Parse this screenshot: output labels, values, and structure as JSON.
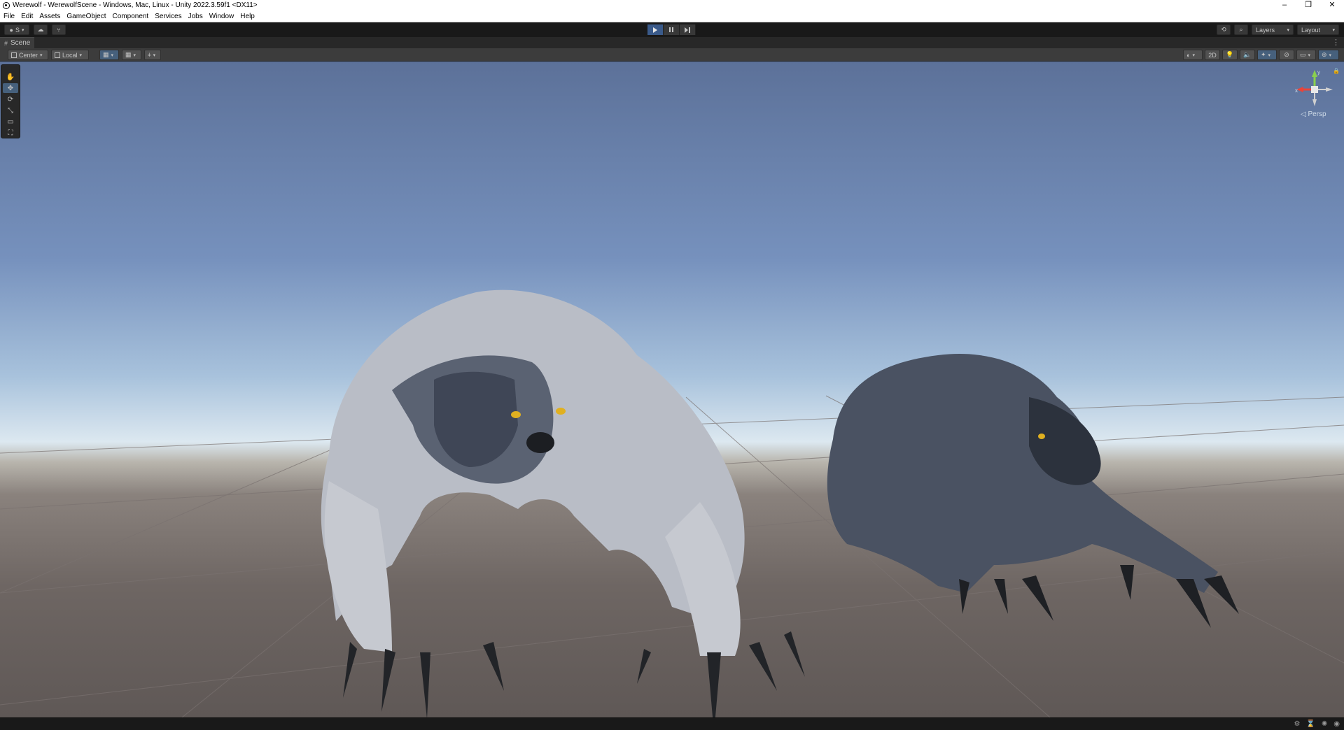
{
  "window": {
    "title": "Werewolf - WerewolfScene - Windows, Mac, Linux - Unity 2022.3.59f1 <DX11>",
    "controls": [
      "–",
      "❐",
      "✕"
    ]
  },
  "menu": [
    "File",
    "Edit",
    "Assets",
    "GameObject",
    "Component",
    "Services",
    "Jobs",
    "Window",
    "Help"
  ],
  "toolbar": {
    "account_label": "S",
    "layers_label": "Layers",
    "layout_label": "Layout"
  },
  "scene_tab": {
    "label": "Scene"
  },
  "scene_toolbar": {
    "pivot_label": "Center",
    "space_label": "Local",
    "mode_2d_label": "2D"
  },
  "gizmo": {
    "persp_label": "◁ Persp",
    "axis_x": "x",
    "axis_y": "y"
  },
  "colors": {
    "play_active": "#3a5a8a",
    "tool_active": "#46607c",
    "gizmo_y": "#8ad04e",
    "gizmo_x": "#e8443a"
  }
}
